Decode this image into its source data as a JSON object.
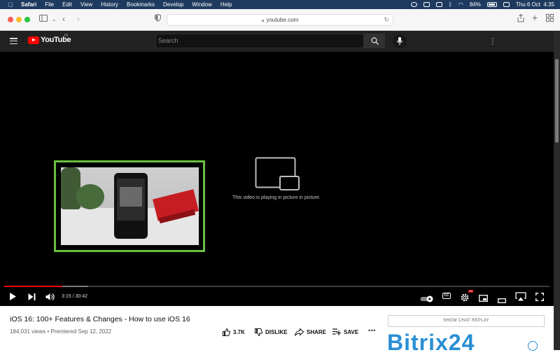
{
  "menubar": {
    "app_name": "Safari",
    "menus": [
      "File",
      "Edit",
      "View",
      "History",
      "Bookmarks",
      "Develop",
      "Window",
      "Help"
    ],
    "battery": "84%",
    "datetime": "Thu 6 Oct  4:35"
  },
  "browser": {
    "url": "youtube.com"
  },
  "youtube": {
    "wordmark": "YouTube",
    "country": "IN",
    "search_placeholder": "Search"
  },
  "player": {
    "pip_message": "This video is playing in picture in picture.",
    "time": "3:15 / 30:42",
    "played_fraction": 0.106,
    "buffered_fraction": 0.154,
    "cc_label": "CC",
    "hd_label": "HD"
  },
  "video": {
    "title": "iOS 16: 100+ Features & Changes - How to use iOS 16",
    "meta": "184,031 views • Premiered Sep 12, 2022",
    "likes": "3.7K",
    "dislike_label": "DISLIKE",
    "share_label": "SHARE",
    "save_label": "SAVE"
  },
  "sidebar": {
    "chat_replay_label": "SHOW CHAT REPLAY",
    "ad_text": "Bitrix24"
  }
}
